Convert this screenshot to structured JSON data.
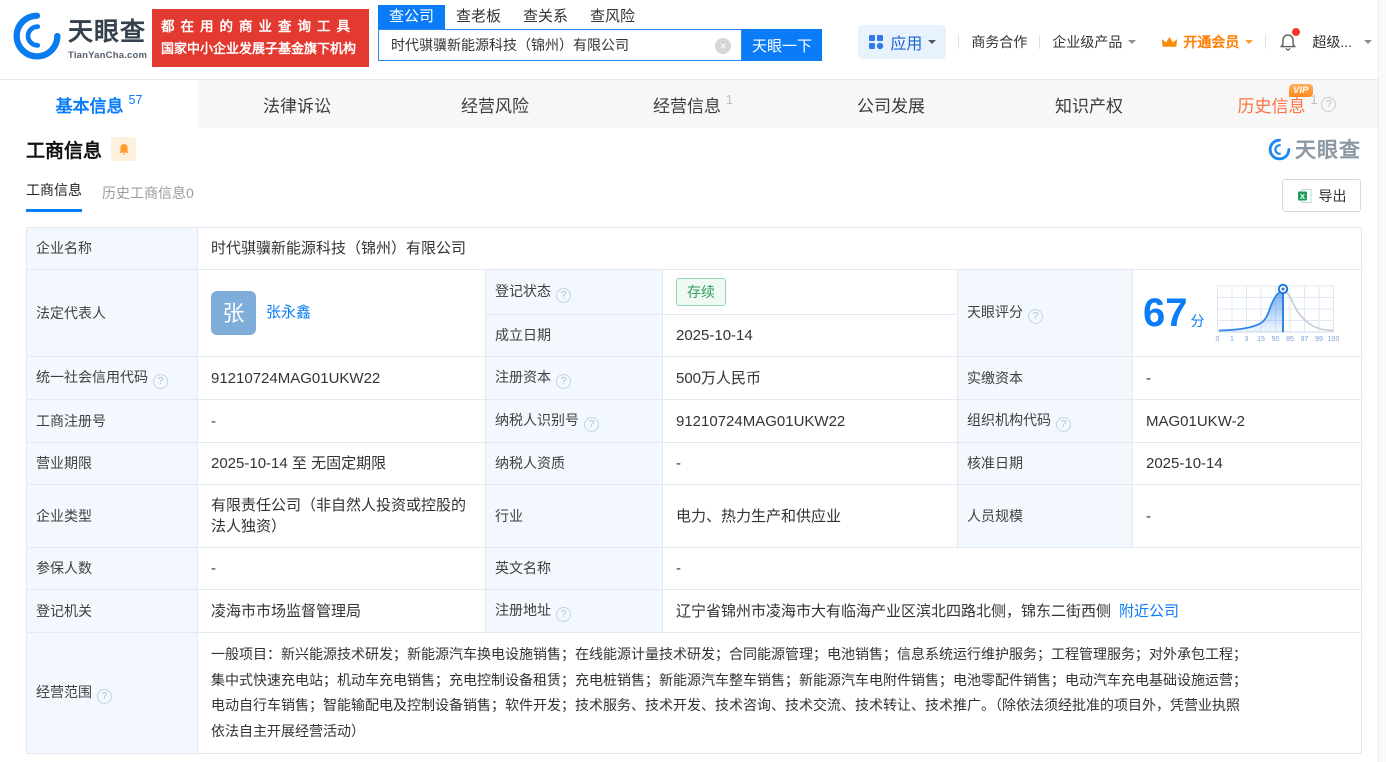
{
  "brand": {
    "name": "天眼查",
    "domain": "TianYanCha.com",
    "slogan_line1": "都在用的商业查询工具",
    "slogan_line2": "国家中小企业发展子基金旗下机构"
  },
  "search": {
    "tabs": [
      "查公司",
      "查老板",
      "查关系",
      "查风险"
    ],
    "value": "时代骐骥新能源科技（锦州）有限公司",
    "button": "天眼一下"
  },
  "topmenu": {
    "apps": "应用",
    "biz": "商务合作",
    "enterprise": "企业级产品",
    "vip": "开通会员",
    "super": "超级..."
  },
  "nav": {
    "tabs": [
      {
        "label": "基本信息",
        "count": "57"
      },
      {
        "label": "法律诉讼",
        "count": ""
      },
      {
        "label": "经营风险",
        "count": ""
      },
      {
        "label": "经营信息",
        "count": "1"
      },
      {
        "label": "公司发展",
        "count": ""
      },
      {
        "label": "知识产权",
        "count": ""
      },
      {
        "label": "历史信息",
        "count": "1",
        "vip": "VIP"
      }
    ]
  },
  "section": {
    "title": "工商信息",
    "watermark": "天眼查"
  },
  "subtabs": {
    "active": "工商信息",
    "inactive": "历史工商信息0",
    "export": "导出"
  },
  "table": {
    "company_name": {
      "label": "企业名称",
      "value": "时代骐骥新能源科技（锦州）有限公司"
    },
    "legal_rep": {
      "label": "法定代表人",
      "avatar": "张",
      "name": "张永鑫"
    },
    "reg_status": {
      "label": "登记状态",
      "value": "存续"
    },
    "est_date": {
      "label": "成立日期",
      "value": "2025-10-14"
    },
    "score": {
      "label": "天眼评分",
      "value": "67",
      "unit": "分"
    },
    "credit_code": {
      "label": "统一社会信用代码",
      "value": "91210724MAG01UKW22"
    },
    "reg_capital": {
      "label": "注册资本",
      "value": "500万人民币"
    },
    "paid_capital": {
      "label": "实缴资本",
      "value": "-"
    },
    "reg_number": {
      "label": "工商注册号",
      "value": "-"
    },
    "taxpayer_id": {
      "label": "纳税人识别号",
      "value": "91210724MAG01UKW22"
    },
    "org_code": {
      "label": "组织机构代码",
      "value": "MAG01UKW-2"
    },
    "biz_term": {
      "label": "营业期限",
      "value": "2025-10-14 至 无固定期限"
    },
    "taxpayer_quality": {
      "label": "纳税人资质",
      "value": "-"
    },
    "approval_date": {
      "label": "核准日期",
      "value": "2025-10-14"
    },
    "company_type": {
      "label": "企业类型",
      "value": "有限责任公司（非自然人投资或控股的法人独资）"
    },
    "industry": {
      "label": "行业",
      "value": "电力、热力生产和供应业"
    },
    "staff_size": {
      "label": "人员规模",
      "value": "-"
    },
    "insured_count": {
      "label": "参保人数",
      "value": "-"
    },
    "english_name": {
      "label": "英文名称",
      "value": "-"
    },
    "reg_authority": {
      "label": "登记机关",
      "value": "凌海市市场监督管理局"
    },
    "reg_address": {
      "label": "注册地址",
      "value": "辽宁省锦州市凌海市大有临海产业区滨北四路北侧，锦东二街西侧",
      "link": "附近公司"
    },
    "business_scope": {
      "label": "经营范围",
      "value": "一般项目：新兴能源技术研发；新能源汽车换电设施销售；在线能源计量技术研发；合同能源管理；电池销售；信息系统运行维护服务；工程管理服务；对外承包工程；集中式快速充电站；机动车充电销售；充电控制设备租赁；充电桩销售；新能源汽车整车销售；新能源汽车电附件销售；电池零配件销售；电动汽车充电基础设施运营；电动自行车销售；智能输配电及控制设备销售；软件开发；技术服务、技术开发、技术咨询、技术交流、技术转让、技术推广。（除依法须经批准的项目外，凭营业执照依法自主开展经营活动）"
    }
  },
  "chart_data": {
    "type": "area",
    "title": "天眼评分",
    "score": 67,
    "x_ticks": [
      "0",
      "1",
      "3",
      "15",
      "50",
      "85",
      "97",
      "99",
      "100"
    ]
  }
}
